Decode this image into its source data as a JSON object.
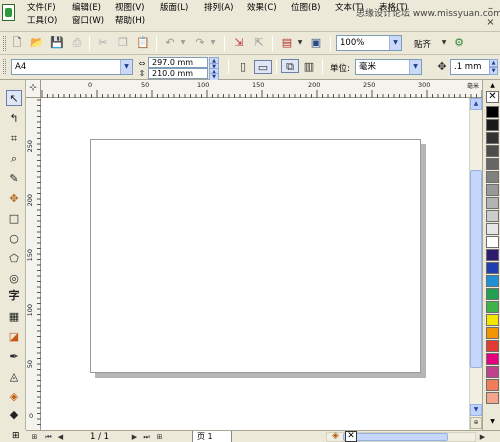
{
  "menu": {
    "row1": [
      "文件(F)",
      "编辑(E)",
      "视图(V)",
      "版面(L)",
      "排列(A)",
      "效果(C)",
      "位图(B)",
      "文本(T)",
      "表格(T)"
    ],
    "row2": [
      "工具(O)",
      "窗口(W)",
      "帮助(H)"
    ]
  },
  "watermark": "思缘设计论坛  www.missyuan.com",
  "toolbar": {
    "zoom_value": "100%",
    "snap_label": "贴齐"
  },
  "property_bar": {
    "paper_size": "A4",
    "width": "297.0 mm",
    "height": "210.0 mm",
    "units_label": "单位:",
    "units_value": "毫米",
    "nudge_value": ".1 mm"
  },
  "ruler": {
    "h_labels": [
      "0",
      "50",
      "100",
      "150",
      "200",
      "250",
      "300",
      "毫米"
    ],
    "v_labels": [
      "250",
      "200",
      "150",
      "100",
      "50",
      "0"
    ]
  },
  "pager": {
    "page_count": "1 / 1",
    "tab_label": "页 1"
  },
  "palette_colors": [
    "#ffffff",
    "#000000",
    "#1a1a1a",
    "#333333",
    "#4d4d4d",
    "#666666",
    "#808080",
    "#999999",
    "#b3b3b3",
    "#cccccc",
    "#e6e6e6",
    "#ffffff",
    "#2e1a6e",
    "#1e3fb0",
    "#1f8fd6",
    "#20a050",
    "#3db34a",
    "#f2e600",
    "#f29400",
    "#e03c31",
    "#e4007f",
    "#c0408c",
    "#f07c5a",
    "#f3a58c"
  ],
  "icons": {
    "left_tools": [
      "pick-icon",
      "shape-icon",
      "crop-icon",
      "zoom-icon",
      "freehand-icon",
      "smart-fill-icon",
      "rectangle-icon",
      "ellipse-icon",
      "polygon-icon",
      "basic-shapes-icon",
      "text-icon",
      "table-icon",
      "blend-icon",
      "eyedropper-icon",
      "outline-icon",
      "fill-icon",
      "interactive-fill-icon"
    ]
  }
}
